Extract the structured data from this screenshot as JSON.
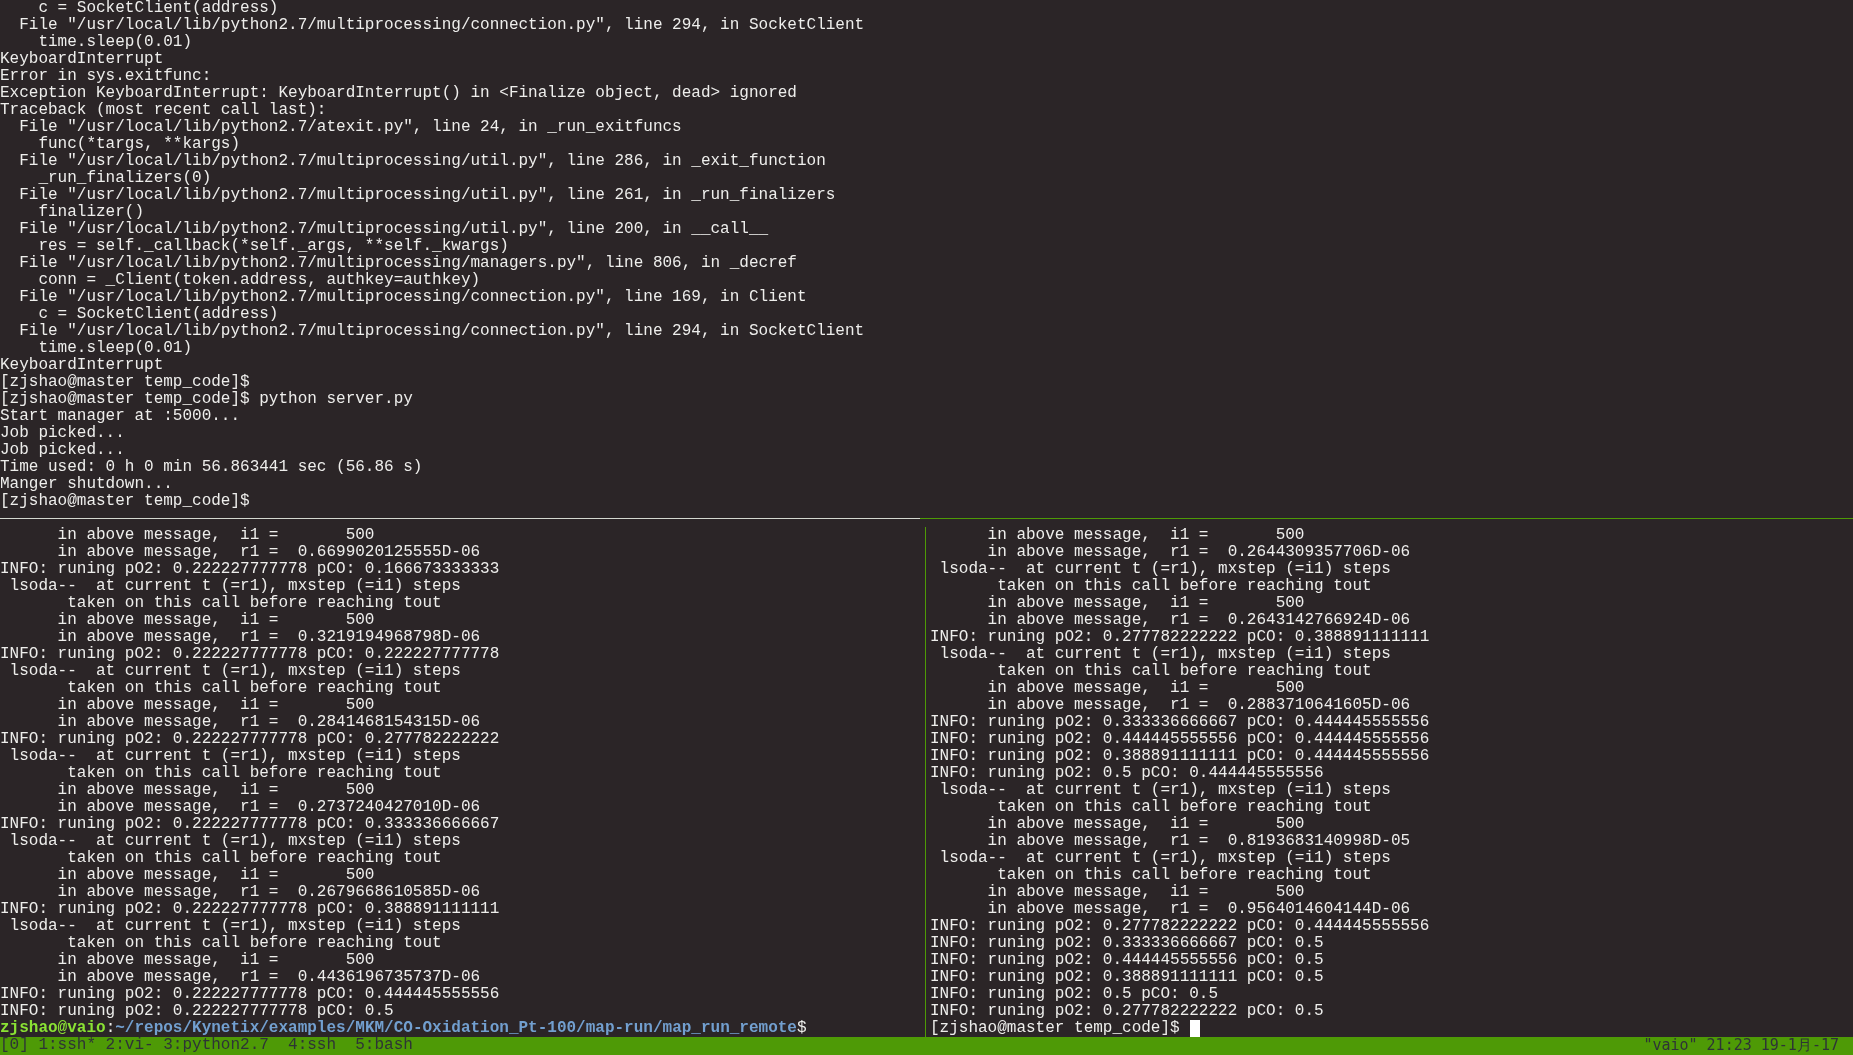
{
  "top_pane": {
    "lines": [
      "    c = SocketClient(address)",
      "  File \"/usr/local/lib/python2.7/multiprocessing/connection.py\", line 294, in SocketClient",
      "    time.sleep(0.01)",
      "KeyboardInterrupt",
      "Error in sys.exitfunc:",
      "Exception KeyboardInterrupt: KeyboardInterrupt() in <Finalize object, dead> ignored",
      "Traceback (most recent call last):",
      "  File \"/usr/local/lib/python2.7/atexit.py\", line 24, in _run_exitfuncs",
      "    func(*targs, **kargs)",
      "  File \"/usr/local/lib/python2.7/multiprocessing/util.py\", line 286, in _exit_function",
      "    _run_finalizers(0)",
      "  File \"/usr/local/lib/python2.7/multiprocessing/util.py\", line 261, in _run_finalizers",
      "    finalizer()",
      "  File \"/usr/local/lib/python2.7/multiprocessing/util.py\", line 200, in __call__",
      "    res = self._callback(*self._args, **self._kwargs)",
      "  File \"/usr/local/lib/python2.7/multiprocessing/managers.py\", line 806, in _decref",
      "    conn = _Client(token.address, authkey=authkey)",
      "  File \"/usr/local/lib/python2.7/multiprocessing/connection.py\", line 169, in Client",
      "    c = SocketClient(address)",
      "  File \"/usr/local/lib/python2.7/multiprocessing/connection.py\", line 294, in SocketClient",
      "    time.sleep(0.01)",
      "KeyboardInterrupt",
      "[zjshao@master temp_code]$",
      "[zjshao@master temp_code]$ python server.py",
      "Start manager at :5000...",
      "Job picked...",
      "Job picked...",
      "Time used: 0 h 0 min 56.863441 sec (56.86 s)",
      "Manger shutdown...",
      "[zjshao@master temp_code]$"
    ],
    "active": false
  },
  "bottom_panes": [
    {
      "active": false,
      "lines": [
        "      in above message,  i1 =       500",
        "      in above message,  r1 =  0.6699020125555D-06",
        "INFO: runing pO2: 0.222227777778 pCO: 0.166673333333",
        " lsoda--  at current t (=r1), mxstep (=i1) steps",
        "       taken on this call before reaching tout",
        "      in above message,  i1 =       500",
        "      in above message,  r1 =  0.3219194968798D-06",
        "INFO: runing pO2: 0.222227777778 pCO: 0.222227777778",
        " lsoda--  at current t (=r1), mxstep (=i1) steps",
        "       taken on this call before reaching tout",
        "      in above message,  i1 =       500",
        "      in above message,  r1 =  0.2841468154315D-06",
        "INFO: runing pO2: 0.222227777778 pCO: 0.277782222222",
        " lsoda--  at current t (=r1), mxstep (=i1) steps",
        "       taken on this call before reaching tout",
        "      in above message,  i1 =       500",
        "      in above message,  r1 =  0.2737240427010D-06",
        "INFO: runing pO2: 0.222227777778 pCO: 0.333336666667",
        " lsoda--  at current t (=r1), mxstep (=i1) steps",
        "       taken on this call before reaching tout",
        "      in above message,  i1 =       500",
        "      in above message,  r1 =  0.2679668610585D-06",
        "INFO: runing pO2: 0.222227777778 pCO: 0.388891111111",
        " lsoda--  at current t (=r1), mxstep (=i1) steps",
        "       taken on this call before reaching tout",
        "      in above message,  i1 =       500",
        "      in above message,  r1 =  0.4436196735737D-06",
        "INFO: runing pO2: 0.222227777778 pCO: 0.444445555556",
        "INFO: runing pO2: 0.222227777778 pCO: 0.5"
      ],
      "prompt": {
        "cursor": false,
        "segments": [
          {
            "kind": "user_host",
            "text": "zjshao@vaio"
          },
          {
            "kind": "plain",
            "text": ":"
          },
          {
            "kind": "path",
            "text": "~/repos/Kynetix/examples/MKM/CO-Oxidation_Pt-100/map-run/map_run_remote"
          },
          {
            "kind": "plain",
            "text": "$"
          }
        ]
      }
    },
    {
      "active": true,
      "lines": [
        "      in above message,  i1 =       500",
        "      in above message,  r1 =  0.2644309357706D-06",
        " lsoda--  at current t (=r1), mxstep (=i1) steps",
        "       taken on this call before reaching tout",
        "      in above message,  i1 =       500",
        "      in above message,  r1 =  0.2643142766924D-06",
        "INFO: runing pO2: 0.277782222222 pCO: 0.388891111111",
        " lsoda--  at current t (=r1), mxstep (=i1) steps",
        "       taken on this call before reaching tout",
        "      in above message,  i1 =       500",
        "      in above message,  r1 =  0.2883710641605D-06",
        "INFO: runing pO2: 0.333336666667 pCO: 0.444445555556",
        "INFO: runing pO2: 0.444445555556 pCO: 0.444445555556",
        "INFO: runing pO2: 0.388891111111 pCO: 0.444445555556",
        "INFO: runing pO2: 0.5 pCO: 0.444445555556",
        " lsoda--  at current t (=r1), mxstep (=i1) steps",
        "       taken on this call before reaching tout",
        "      in above message,  i1 =       500",
        "      in above message,  r1 =  0.8193683140998D-05",
        " lsoda--  at current t (=r1), mxstep (=i1) steps",
        "       taken on this call before reaching tout",
        "      in above message,  i1 =       500",
        "      in above message,  r1 =  0.9564014604144D-06",
        "INFO: runing pO2: 0.277782222222 pCO: 0.444445555556",
        "INFO: runing pO2: 0.333336666667 pCO: 0.5",
        "INFO: runing pO2: 0.444445555556 pCO: 0.5",
        "INFO: runing pO2: 0.388891111111 pCO: 0.5",
        "INFO: runing pO2: 0.5 pCO: 0.5",
        "INFO: runing pO2: 0.277782222222 pCO: 0.5"
      ],
      "prompt": {
        "cursor": true,
        "segments": [
          {
            "kind": "plain",
            "text": "[zjshao@master temp_code]$"
          }
        ]
      }
    }
  ],
  "status_bar": {
    "windows": "[0] 1:ssh* 2:vi- 3:python2.7  4:ssh  5:bash",
    "right": "\"vaio\" 21:23 19-1月-17"
  }
}
